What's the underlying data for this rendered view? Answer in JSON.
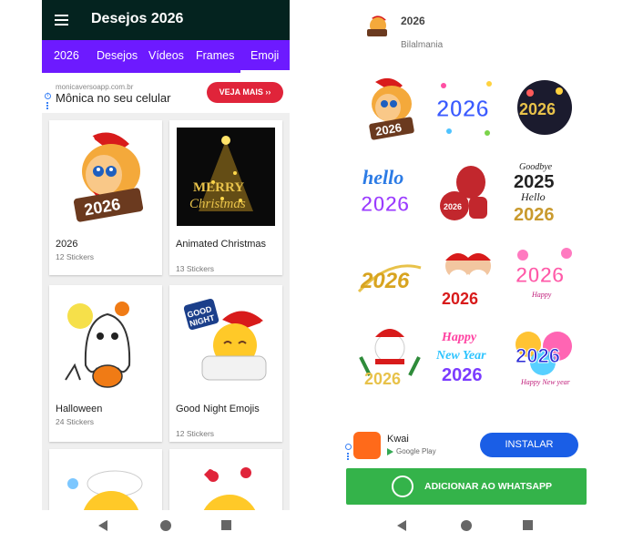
{
  "left_screen": {
    "app_title": "Desejos 2026",
    "tabs": [
      {
        "label": "2026"
      },
      {
        "label": "Desejos"
      },
      {
        "label": "Vídeos"
      },
      {
        "label": "Frames"
      },
      {
        "label": "Emoji"
      }
    ],
    "ad": {
      "url": "monicaversoapp.com.br",
      "text": "Mônica no seu celular",
      "cta": "VEJA MAIS"
    },
    "packs": [
      {
        "name": "2026",
        "count": "12 Stickers"
      },
      {
        "name": "Animated Christmas",
        "count": "13 Stickers"
      },
      {
        "name": "Halloween",
        "count": "24 Stickers"
      },
      {
        "name": "Good Night Emojis",
        "count": "12 Stickers"
      }
    ]
  },
  "right_screen": {
    "pack_title": "2026",
    "author": "Bilalmania",
    "ad": {
      "app_name": "Kwai",
      "store": "Google Play",
      "install_label": "INSTALAR"
    },
    "add_button_label": "ADICIONAR AO WHATSAPP"
  },
  "colors": {
    "topbar": "#04231f",
    "tabs": "#6d1aff",
    "ad_cta": "#e0243a",
    "install": "#1a5ee6",
    "whatsapp": "#34b34a"
  }
}
